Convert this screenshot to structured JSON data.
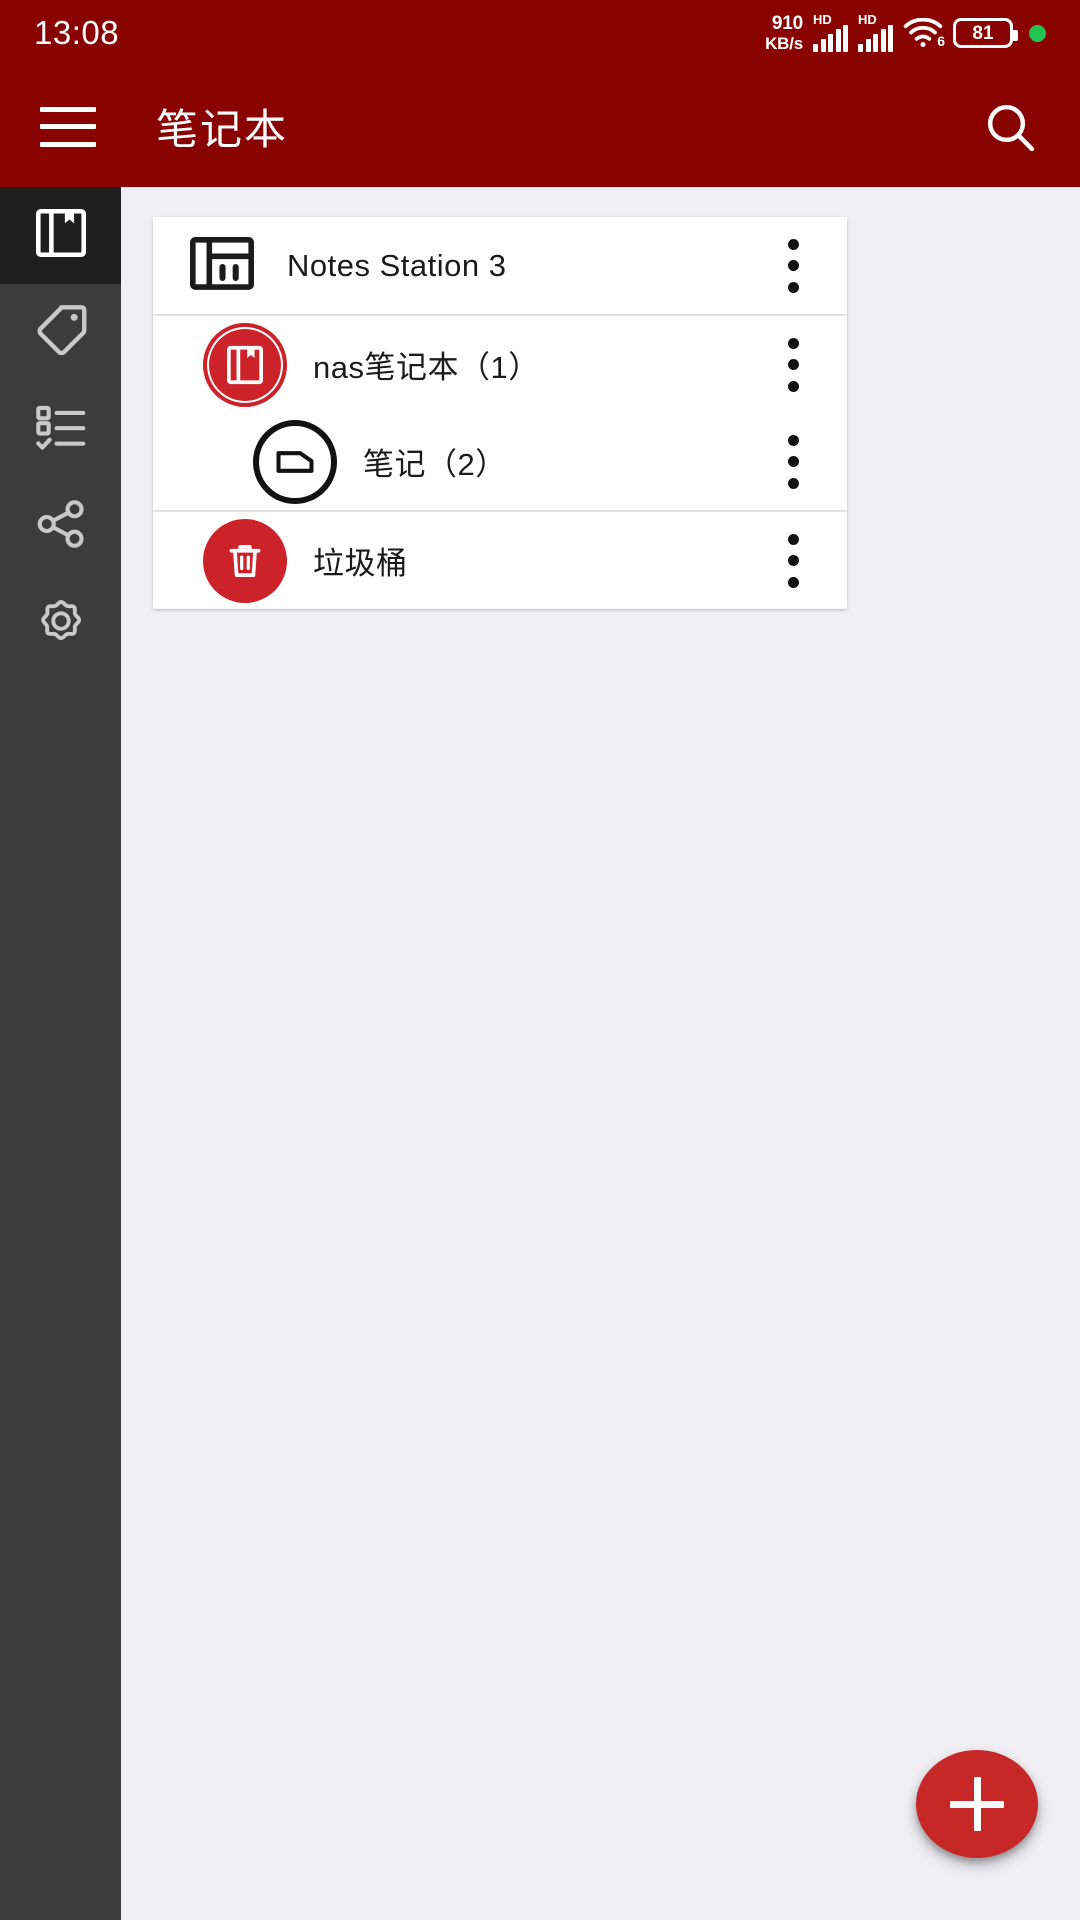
{
  "status_bar": {
    "time": "13:08",
    "network_speed_value": "910",
    "network_speed_unit": "KB/s",
    "sim1_label": "HD",
    "sim2_label": "HD",
    "wifi_generation": "6",
    "battery_percent": "81",
    "indicator_dot_color": "#23c552"
  },
  "app_bar": {
    "menu_icon": "hamburger-menu-icon",
    "title": "笔记本",
    "search_icon": "search-icon",
    "background_color": "#8a0303"
  },
  "sidebar": {
    "background_color": "#3c3c3c",
    "active_background_color": "#1f1f1f",
    "items": [
      {
        "name": "notebook",
        "icon": "notebook-icon",
        "active": true
      },
      {
        "name": "tag",
        "icon": "tag-icon",
        "active": false
      },
      {
        "name": "todo",
        "icon": "checklist-icon",
        "active": false
      },
      {
        "name": "share",
        "icon": "share-icon",
        "active": false
      },
      {
        "name": "settings",
        "icon": "gear-icon",
        "active": false
      }
    ]
  },
  "notebook_list": {
    "rows": [
      {
        "label": "Notes Station 3",
        "icon": "notes-station-app-icon",
        "icon_style": "outline-square",
        "indent": 0,
        "menu_icon": "more-vertical-icon"
      },
      {
        "label": "nas笔记本（1）",
        "icon": "notebook-icon",
        "icon_style": "red-ring",
        "indent": 1,
        "menu_icon": "more-vertical-icon"
      },
      {
        "label": "笔记（2）",
        "icon": "note-tag-icon",
        "icon_style": "black-outline",
        "indent": 2,
        "menu_icon": "more-vertical-icon"
      },
      {
        "label": "垃圾桶",
        "icon": "trash-icon",
        "icon_style": "red-filled",
        "indent": 1,
        "menu_icon": "more-vertical-icon"
      }
    ]
  },
  "fab": {
    "icon": "plus-icon",
    "color": "#c62828"
  },
  "theme": {
    "primary": "#8a0303",
    "accent_red": "#cc2229",
    "page_background": "#f0eff4",
    "card_background": "#ffffff"
  }
}
